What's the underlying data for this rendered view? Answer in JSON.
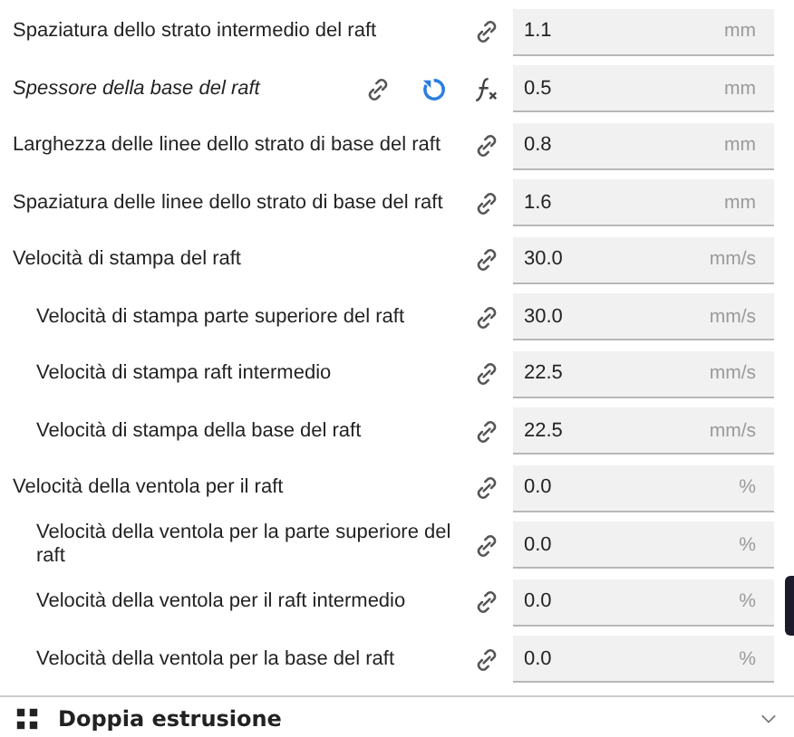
{
  "settings": [
    {
      "label": "Spaziatura dello strato intermedio del raft",
      "value": "1.1",
      "unit": "mm",
      "modified": false,
      "formula": false
    },
    {
      "label": "Spessore della base del raft",
      "value": "0.5",
      "unit": "mm",
      "modified": true,
      "formula": true
    },
    {
      "label": "Larghezza delle linee dello strato di base del raft",
      "value": "0.8",
      "unit": "mm",
      "modified": false,
      "formula": false
    },
    {
      "label": "Spaziatura delle linee dello strato di base del raft",
      "value": "1.6",
      "unit": "mm",
      "modified": false,
      "formula": false
    },
    {
      "label": "Velocità di stampa del raft",
      "value": "30.0",
      "unit": "mm/s",
      "modified": false,
      "formula": false,
      "children": [
        {
          "label": "Velocità di stampa parte superiore del raft",
          "value": "30.0",
          "unit": "mm/s",
          "modified": false,
          "formula": false
        },
        {
          "label": "Velocità di stampa raft intermedio",
          "value": "22.5",
          "unit": "mm/s",
          "modified": false,
          "formula": false
        },
        {
          "label": "Velocità di stampa della base del raft",
          "value": "22.5",
          "unit": "mm/s",
          "modified": false,
          "formula": false
        }
      ]
    },
    {
      "label": "Velocità della ventola per il raft",
      "value": "0.0",
      "unit": "%",
      "modified": false,
      "formula": false,
      "children": [
        {
          "label": "Velocità della ventola per la parte superiore del raft",
          "value": "0.0",
          "unit": "%",
          "modified": false,
          "formula": false
        },
        {
          "label": "Velocità della ventola per il raft intermedio",
          "value": "0.0",
          "unit": "%",
          "modified": false,
          "formula": false
        },
        {
          "label": "Velocità della ventola per la base del raft",
          "value": "0.0",
          "unit": "%",
          "modified": false,
          "formula": false
        }
      ]
    }
  ],
  "next_section": {
    "title": "Doppia estrusione",
    "expanded": false
  }
}
